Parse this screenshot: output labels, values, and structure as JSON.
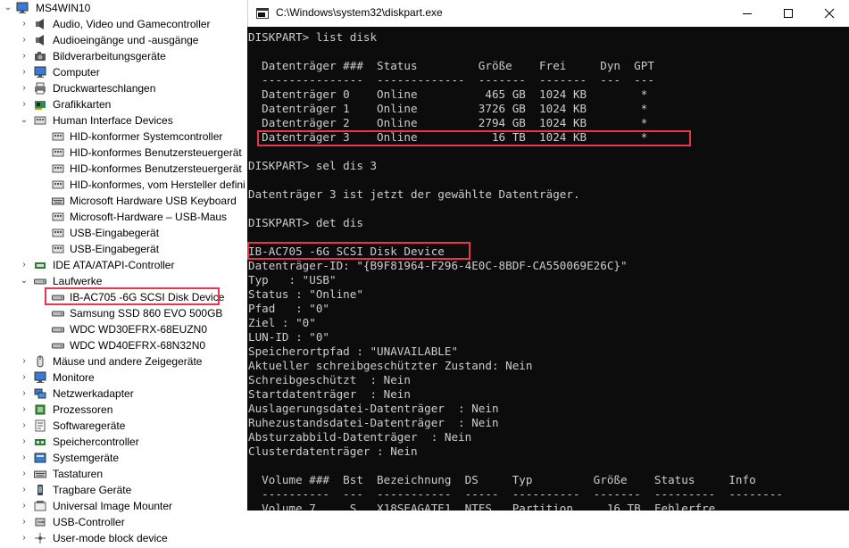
{
  "tree": {
    "root": "MS4WIN10",
    "items": [
      {
        "label": "Audio, Video und Gamecontroller",
        "icon": "speaker-icon"
      },
      {
        "label": "Audioeingänge und -ausgänge",
        "icon": "speaker-icon"
      },
      {
        "label": "Bildverarbeitungsgeräte",
        "icon": "camera-icon"
      },
      {
        "label": "Computer",
        "icon": "monitor-icon"
      },
      {
        "label": "Druckwarteschlangen",
        "icon": "printer-icon"
      },
      {
        "label": "Grafikkarten",
        "icon": "display-adapter-icon"
      },
      {
        "label": "Human Interface Devices",
        "icon": "hid-icon"
      },
      {
        "label": "HID-konformer Systemcontroller",
        "icon": "hid-icon"
      },
      {
        "label": "HID-konformes Benutzersteuergerät",
        "icon": "hid-icon"
      },
      {
        "label": "HID-konformes Benutzersteuergerät",
        "icon": "hid-icon"
      },
      {
        "label": "HID-konformes, vom Hersteller defini",
        "icon": "hid-icon"
      },
      {
        "label": "Microsoft Hardware USB Keyboard",
        "icon": "keyboard-icon"
      },
      {
        "label": "Microsoft-Hardware – USB-Maus",
        "icon": "hid-icon"
      },
      {
        "label": "USB-Eingabegerät",
        "icon": "hid-icon"
      },
      {
        "label": "USB-Eingabegerät",
        "icon": "hid-icon"
      },
      {
        "label": "IDE ATA/ATAPI-Controller",
        "icon": "ide-controller-icon"
      },
      {
        "label": "Laufwerke",
        "icon": "disk-drive-icon"
      },
      {
        "label": "IB-AC705 -6G SCSI Disk Device",
        "icon": "disk-drive-icon"
      },
      {
        "label": "Samsung SSD 860 EVO 500GB",
        "icon": "disk-drive-icon"
      },
      {
        "label": "WDC WD30EFRX-68EUZN0",
        "icon": "disk-drive-icon"
      },
      {
        "label": "WDC WD40EFRX-68N32N0",
        "icon": "disk-drive-icon"
      },
      {
        "label": "Mäuse und andere Zeigegeräte",
        "icon": "mouse-icon"
      },
      {
        "label": "Monitore",
        "icon": "monitor-icon"
      },
      {
        "label": "Netzwerkadapter",
        "icon": "network-icon"
      },
      {
        "label": "Prozessoren",
        "icon": "processor-icon"
      },
      {
        "label": "Softwaregeräte",
        "icon": "software-device-icon"
      },
      {
        "label": "Speichercontroller",
        "icon": "storage-controller-icon"
      },
      {
        "label": "Systemgeräte",
        "icon": "system-device-icon"
      },
      {
        "label": "Tastaturen",
        "icon": "keyboard-icon"
      },
      {
        "label": "Tragbare Geräte",
        "icon": "portable-device-icon"
      },
      {
        "label": "Universal Image Mounter",
        "icon": "image-mounter-icon"
      },
      {
        "label": "USB-Controller",
        "icon": "usb-icon"
      },
      {
        "label": "User-mode block device",
        "icon": "block-device-icon"
      }
    ]
  },
  "console": {
    "title": "C:\\Windows\\system32\\diskpart.exe",
    "lines": [
      "DISKPART> list disk",
      "",
      "  Datenträger ###  Status         Größe    Frei     Dyn  GPT",
      "  ---------------  -------------  -------  -------  ---  ---",
      "  Datenträger 0    Online          465 GB  1024 KB        *",
      "  Datenträger 1    Online         3726 GB  1024 KB        *",
      "  Datenträger 2    Online         2794 GB  1024 KB        *",
      "  Datenträger 3    Online           16 TB  1024 KB        *",
      "",
      "DISKPART> sel dis 3",
      "",
      "Datenträger 3 ist jetzt der gewählte Datenträger.",
      "",
      "DISKPART> det dis",
      "",
      "IB-AC705 -6G SCSI Disk Device",
      "Datenträger-ID: \"{B9F81964-F296-4E0C-8BDF-CA550069E26C}\"",
      "Typ   : \"USB\"",
      "Status : \"Online\"",
      "Pfad   : \"0\"",
      "Ziel : \"0\"",
      "LUN-ID : \"0\"",
      "Speicherortpfad : \"UNAVAILABLE\"",
      "Aktueller schreibgeschützter Zustand: Nein",
      "Schreibgeschützt  : Nein",
      "Startdatenträger  : Nein",
      "Auslagerungsdatei-Datenträger  : Nein",
      "Ruhezustandsdatei-Datenträger  : Nein",
      "Absturzabbild-Datenträger  : Nein",
      "Clusterdatenträger : Nein",
      "",
      "  Volume ###  Bst  Bezeichnung  DS     Typ         Größe    Status     Info",
      "  ----------  ---  -----------  -----  ----------  -------  ---------  --------",
      "  Volume 7     S   X18SEAGATE1  NTFS   Partition     16 TB  Fehlerfre"
    ]
  }
}
